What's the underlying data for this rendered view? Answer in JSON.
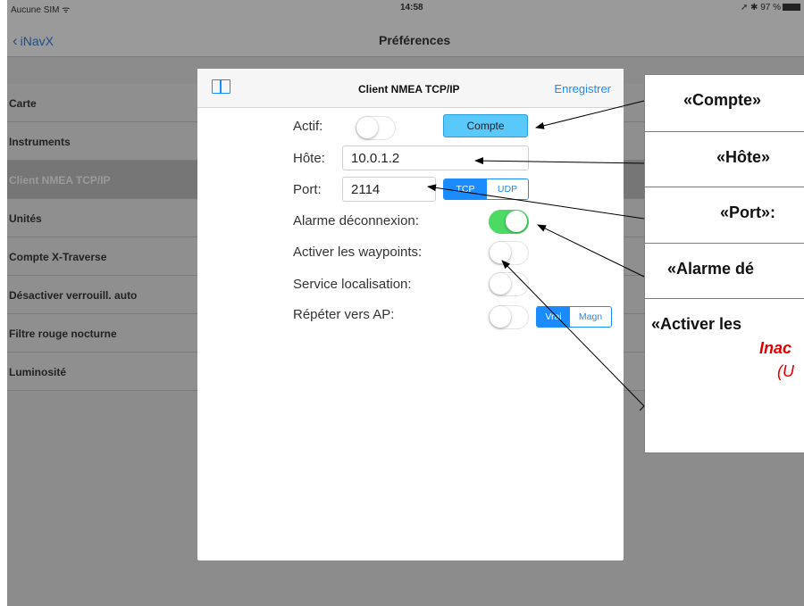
{
  "status_bar": {
    "carrier": "Aucune SIM ᯤ",
    "time": "14:58",
    "battery": "➚ ✱ 97 %"
  },
  "nav_bar": {
    "back_label": "iNavX",
    "title": "Préférences"
  },
  "sidebar": {
    "items": [
      {
        "label": "Carte"
      },
      {
        "label": "Instruments"
      },
      {
        "label": "Client NMEA TCP/IP",
        "selected": true
      },
      {
        "label": "Unités"
      },
      {
        "label": "Compte X-Traverse"
      },
      {
        "label": "Désactiver verrouill. auto"
      },
      {
        "label": "Filtre rouge nocturne"
      },
      {
        "label": "Luminosité"
      }
    ]
  },
  "popover": {
    "title": "Client NMEA TCP/IP",
    "save_label": "Enregistrer",
    "book_icon": "book-icon",
    "actif_label": "Actif:",
    "actif_on": false,
    "compte_button": "Compte",
    "host_label": "Hôte:",
    "host_value": "10.0.1.2",
    "port_label": "Port:",
    "port_value": "2114",
    "protocol_options": [
      "TCP",
      "UDP"
    ],
    "protocol_selected": "TCP",
    "alarm_label": "Alarme déconnexion:",
    "alarm_on": true,
    "waypoints_label": "Activer les waypoints:",
    "waypoints_on": false,
    "location_label": "Service localisation:",
    "location_on": false,
    "repeat_label": "Répéter vers AP:",
    "repeat_on": false,
    "heading_options": [
      "Vrai",
      "Magn"
    ],
    "heading_selected": "Vrai"
  },
  "callouts": [
    {
      "text": "«Compte»"
    },
    {
      "text": "«Hôte»"
    },
    {
      "text": "«Port»:"
    },
    {
      "text": "«Alarme dé"
    },
    {
      "text": "«Activer les"
    }
  ],
  "callout_note": {
    "line1": "Inac",
    "line2": "(U"
  },
  "colors": {
    "accent": "#1a8cff",
    "toggle_on": "#4cd964",
    "compte_button": "#5ac8fa",
    "note_red": "#e00000"
  }
}
